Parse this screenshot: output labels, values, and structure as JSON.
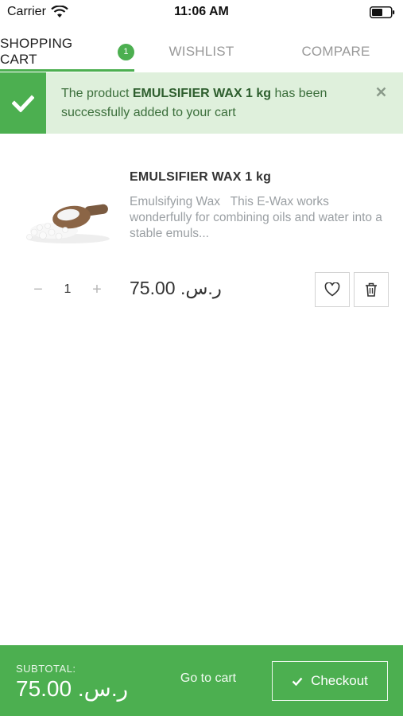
{
  "status_bar": {
    "carrier": "Carrier",
    "time": "11:06 AM"
  },
  "tabs": [
    {
      "label": "SHOPPING CART",
      "badge": "1"
    },
    {
      "label": "WISHLIST"
    },
    {
      "label": "COMPARE"
    }
  ],
  "notification": {
    "prefix": "The product ",
    "product": "EMULSIFIER WAX 1 kg",
    "suffix": " has been successfully added to your cart"
  },
  "cart_item": {
    "title": "EMULSIFIER WAX 1 kg",
    "description": "Emulsifying Wax   This E-Wax works wonderfully for combining oils and water into a stable emuls...",
    "quantity": "1",
    "minus": "−",
    "plus": "+",
    "price": "75.00 .ر.س"
  },
  "footer": {
    "subtotal_label": "SUBTOTAL:",
    "subtotal_value": "75.00 .ر.س",
    "go_to_cart": "Go to cart",
    "checkout": "Checkout"
  },
  "colors": {
    "accent": "#4caf50",
    "notice_bg": "#dff0dc"
  }
}
